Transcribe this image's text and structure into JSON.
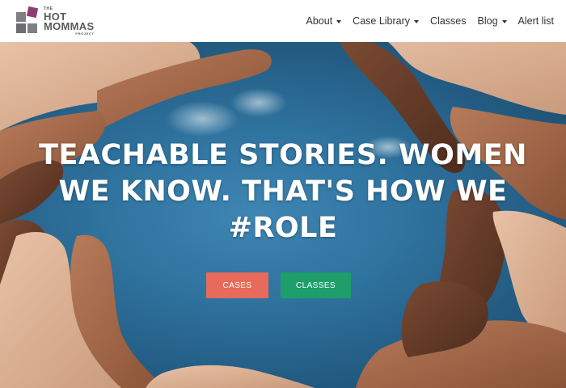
{
  "logo": {
    "the": "THE",
    "hot": "HOT",
    "mommas": "MOMMAS",
    "project": "PROJECT"
  },
  "nav": {
    "items": [
      {
        "label": "About",
        "dropdown": true
      },
      {
        "label": "Case Library",
        "dropdown": true
      },
      {
        "label": "Classes",
        "dropdown": false
      },
      {
        "label": "Blog",
        "dropdown": true
      },
      {
        "label": "Alert list",
        "dropdown": false
      }
    ]
  },
  "hero": {
    "line1": "TEACHABLE STORIES. WOMEN",
    "line2": "WE KNOW. THAT'S HOW WE",
    "line3": "#ROLE",
    "cases_button": "CASES",
    "classes_button": "CLASSES"
  },
  "colors": {
    "accent_cases": "#e86a5a",
    "accent_classes": "#1e9e6b",
    "brand_purple": "#8e3d6f",
    "sky": "#2f739f"
  },
  "icons": {
    "dropdown": "caret-down-icon",
    "logo": "hot-mommas-logo"
  }
}
